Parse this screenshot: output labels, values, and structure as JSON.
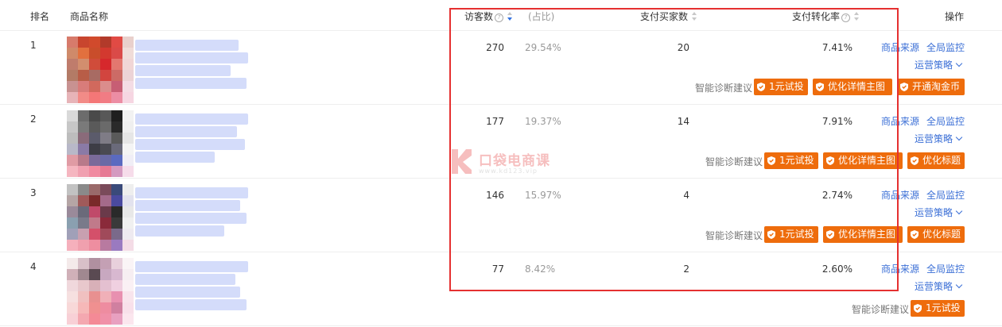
{
  "header": {
    "rank": "排名",
    "name": "商品名称",
    "visitors": "访客数",
    "ratio": "(占比)",
    "buyers": "支付买家数",
    "conversion": "支付转化率",
    "actions": "操作"
  },
  "watermark": {
    "name": "口袋电商课",
    "url": "www.kd123.vip"
  },
  "labels": {
    "source": "商品来源",
    "monitor": "全局监控",
    "strategy": "运营策略",
    "diagnosis": "智能诊断建议"
  },
  "rows": [
    {
      "rank": "1",
      "visitors": "270",
      "ratio": "29.54%",
      "buyers": "20",
      "conversion": "7.41%",
      "buttons": [
        "1元试投",
        "优化详情主图",
        "开通淘金币"
      ]
    },
    {
      "rank": "2",
      "visitors": "177",
      "ratio": "19.37%",
      "buyers": "14",
      "conversion": "7.91%",
      "buttons": [
        "1元试投",
        "优化详情主图",
        "优化标题"
      ]
    },
    {
      "rank": "3",
      "visitors": "146",
      "ratio": "15.97%",
      "buyers": "4",
      "conversion": "2.74%",
      "buttons": [
        "1元试投",
        "优化详情主图",
        "优化标题"
      ]
    },
    {
      "rank": "4",
      "visitors": "77",
      "ratio": "8.42%",
      "buyers": "2",
      "conversion": "2.60%",
      "buttons": [
        "1元试投"
      ]
    }
  ],
  "colors": {
    "accent": "#ee6c0c",
    "link": "#3b6fd6",
    "highlight_box": "#e53030",
    "sort_active": "#3070e0"
  }
}
